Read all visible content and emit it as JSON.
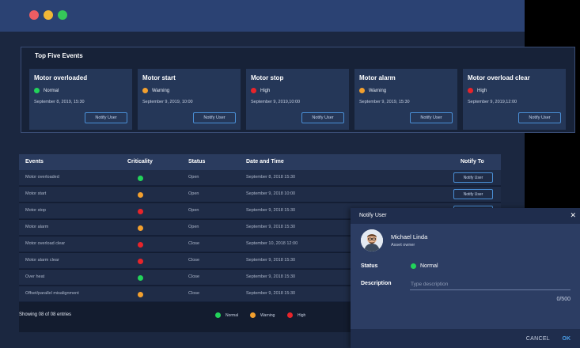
{
  "window": {
    "controls": [
      "close",
      "minimize",
      "maximize"
    ]
  },
  "top_events": {
    "title": "Top Five Events",
    "cards": [
      {
        "title": "Motor overloaded",
        "status": "Normal",
        "level": "normal",
        "date": "September 8, 2019, 15:30",
        "button": "Notify User"
      },
      {
        "title": "Motor start",
        "status": "Warning",
        "level": "warning",
        "date": "September 9, 2019, 10:00",
        "button": "Notify User"
      },
      {
        "title": "Motor stop",
        "status": "High",
        "level": "high",
        "date": "September 9, 2019,10:00",
        "button": "Notify User"
      },
      {
        "title": "Motor alarm",
        "status": "Warning",
        "level": "warning",
        "date": "September 9, 2019, 15:30",
        "button": "Notify User"
      },
      {
        "title": "Motor overload clear",
        "status": "High",
        "level": "high",
        "date": "September 9, 2019,12:00",
        "button": "Notify User"
      }
    ]
  },
  "table": {
    "columns": {
      "events": "Events",
      "criticality": "Criticality",
      "status": "Status",
      "date": "Date and Time",
      "notify": "Notify To"
    },
    "rows": [
      {
        "event": "Motor overloaded",
        "level": "normal",
        "status": "Open",
        "date": "September 8, 2018 15:30",
        "button": "Notify User"
      },
      {
        "event": "Motor start",
        "level": "warning",
        "status": "Open",
        "date": "September 9, 2018 10:00",
        "button": "Notify User"
      },
      {
        "event": "Motor stop",
        "level": "high",
        "status": "Open",
        "date": "September 9, 2018 15:30",
        "button": "Notify User"
      },
      {
        "event": "Motor alarm",
        "level": "warning",
        "status": "Open",
        "date": "September 9, 2018 15:30",
        "button": ""
      },
      {
        "event": "Motor overload clear",
        "level": "high",
        "status": "Close",
        "date": "September 10, 2018 12:00",
        "button": ""
      },
      {
        "event": "Motor alarm clear",
        "level": "high",
        "status": "Close",
        "date": "September 9, 2018 15:30",
        "button": ""
      },
      {
        "event": "Over heat",
        "level": "normal",
        "status": "Close",
        "date": "September 9, 2018 15:30",
        "button": ""
      },
      {
        "event": "Offset/parallel misalignment",
        "level": "warning",
        "status": "Close",
        "date": "September 9, 2018 15:30",
        "button": ""
      }
    ],
    "footer": "Showing 08 of 08 entries",
    "legend": {
      "normal": "Normal",
      "warning": "Warning",
      "high": "High"
    }
  },
  "colors": {
    "normal": "#22d35a",
    "warning": "#f3a02e",
    "high": "#e8242a",
    "accent": "#4a9ee8"
  },
  "dialog": {
    "title": "Notify User",
    "close_icon": "close-icon",
    "user_name": "Michael Linda",
    "user_role": "Asset owner",
    "status_label": "Status",
    "status_value": "Normal",
    "description_label": "Description",
    "description_placeholder": "Type description",
    "counter": "0/500",
    "cancel": "CANCEL",
    "ok": "OK"
  }
}
